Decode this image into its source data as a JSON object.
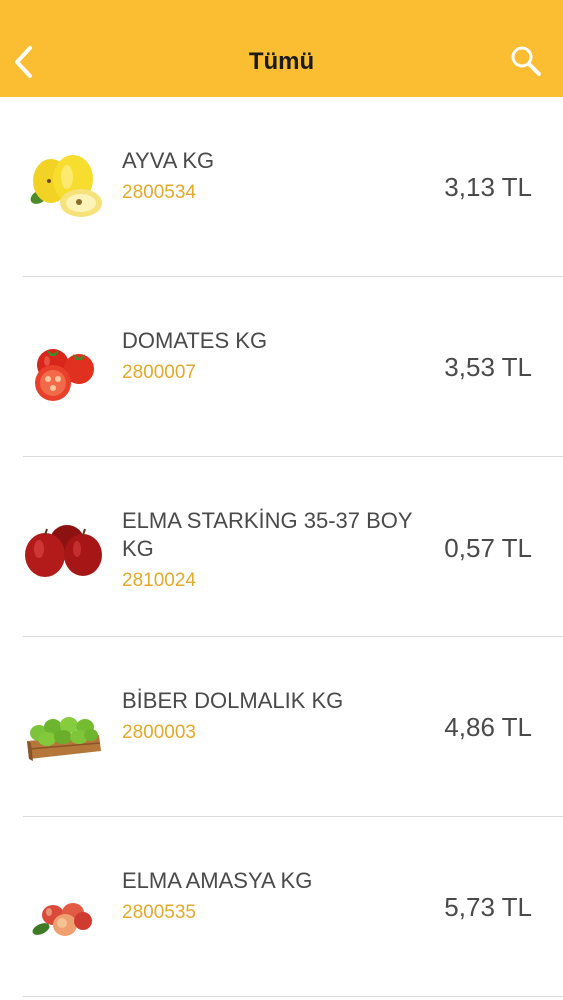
{
  "navbar": {
    "title": "Tümü",
    "back_icon": "chevron-left-icon",
    "search_icon": "search-icon",
    "bg_color": "#fbbd32"
  },
  "products": [
    {
      "name": "AYVA KG",
      "code": "2800534",
      "price": "3,13 TL",
      "image": "quince"
    },
    {
      "name": "DOMATES KG",
      "code": "2800007",
      "price": "3,53 TL",
      "image": "tomato"
    },
    {
      "name": "ELMA STARKİNG 35-37 BOY KG",
      "code": "2810024",
      "price": "0,57 TL",
      "image": "red-apple"
    },
    {
      "name": "BİBER DOLMALIK KG",
      "code": "2800003",
      "price": "4,86 TL",
      "image": "green-pepper"
    },
    {
      "name": "ELMA AMASYA KG",
      "code": "2800535",
      "price": "5,73 TL",
      "image": "amasya-apple"
    }
  ],
  "colors": {
    "code_text": "#e2a92d",
    "main_text": "#4a4a4a"
  }
}
